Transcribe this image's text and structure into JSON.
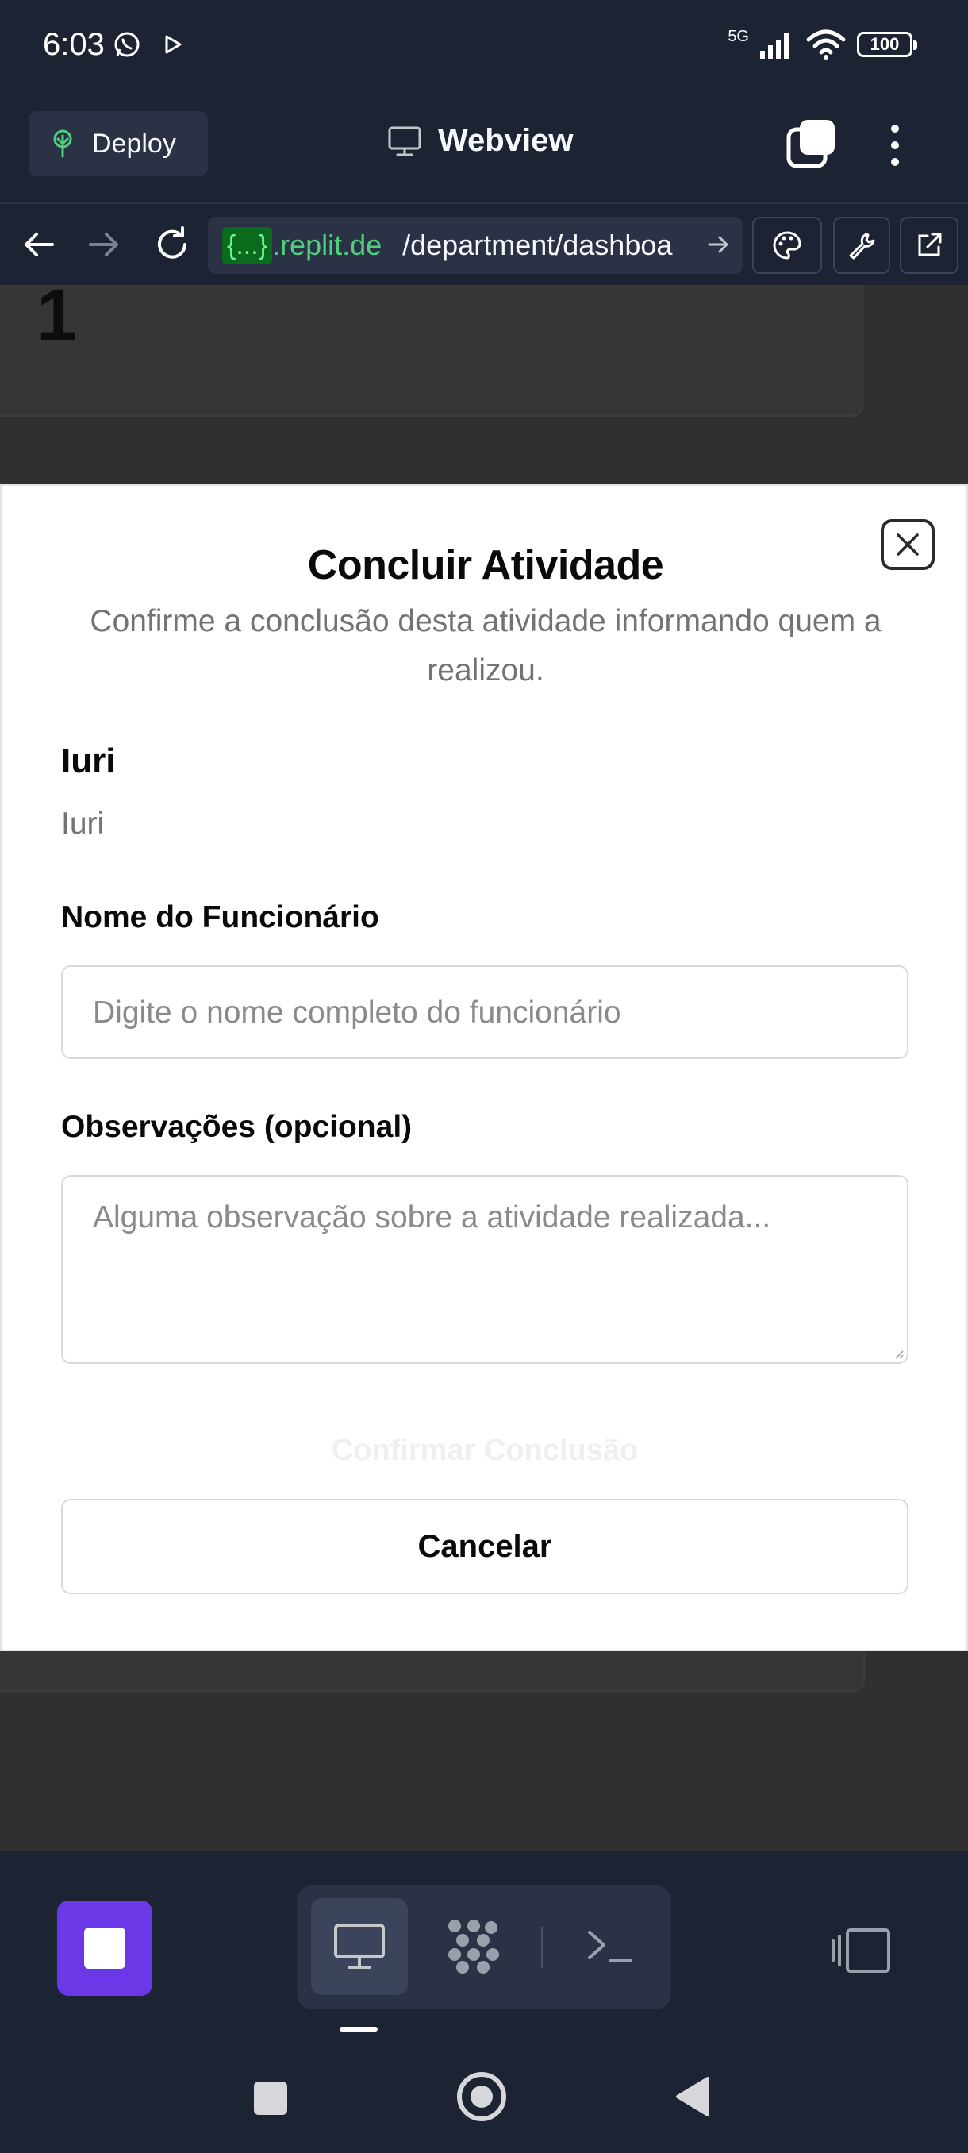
{
  "status_bar": {
    "time": "6:03",
    "network": "5G",
    "battery": "100"
  },
  "header": {
    "deploy_label": "Deploy",
    "title": "Webview"
  },
  "url_bar": {
    "masked": "{...}",
    "domain": ".replit.de",
    "path": "/department/dashboa"
  },
  "background_page": {
    "card_number": "1"
  },
  "modal": {
    "title": "Concluir Atividade",
    "description": "Confirme a conclusão desta atividade informando quem a realizou.",
    "activity_name": "Iuri",
    "activity_description": "Iuri",
    "employee_label": "Nome do Funcionário",
    "employee_placeholder": "Digite o nome completo do funcionário",
    "notes_label": "Observações (opcional)",
    "notes_placeholder": "Alguma observação sobre a atividade realizada...",
    "confirm_label": "Confirmar Conclusão",
    "cancel_label": "Cancelar"
  },
  "dock": {
    "items": [
      "webview-icon",
      "workspace-apps-icon",
      "console-icon"
    ],
    "active": "webview-icon"
  },
  "colors": {
    "app_bg": "#1c2333",
    "surface": "#2b3245",
    "accent_purple": "#6b38e8",
    "url_domain": "#4fd07a"
  }
}
